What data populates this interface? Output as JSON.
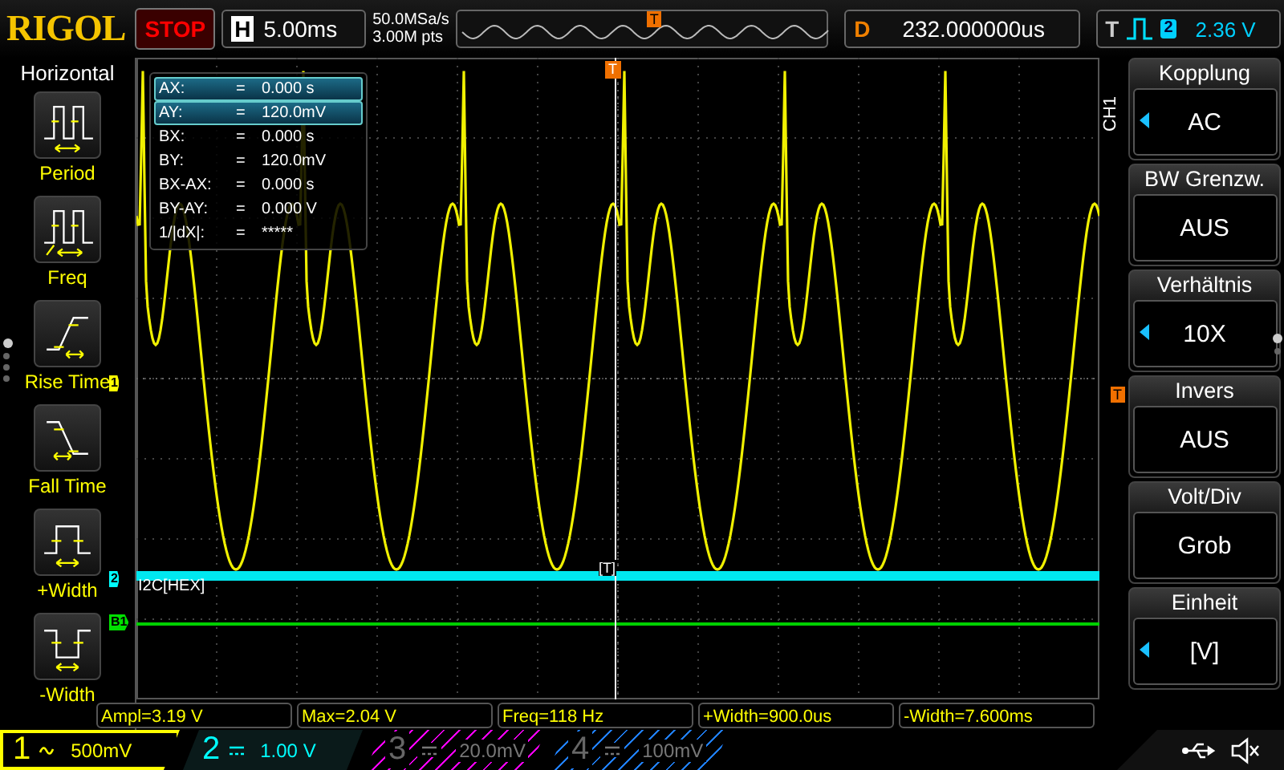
{
  "header": {
    "logo": "RIGOL",
    "run_state": "STOP",
    "timebase_label": "H",
    "timebase": "5.00ms",
    "sample_rate": "50.0MSa/s",
    "memory_depth": "3.00M pts",
    "trigger_marker": "T",
    "delay_label": "D",
    "delay": "232.000000us",
    "trigger_label": "T",
    "trigger_source": "2",
    "trigger_level": "2.36 V"
  },
  "sidebar": {
    "title": "Horizontal",
    "items": [
      {
        "label": "Period",
        "kind": "period"
      },
      {
        "label": "Freq",
        "kind": "freq"
      },
      {
        "label": "Rise Time",
        "kind": "rise"
      },
      {
        "label": "Fall Time",
        "kind": "fall"
      },
      {
        "label": "+Width",
        "kind": "pwidth"
      },
      {
        "label": "-Width",
        "kind": "nwidth"
      }
    ],
    "pages": [
      {
        "selected": true
      },
      {
        "selected": false
      },
      {
        "selected": false
      },
      {
        "selected": false
      }
    ]
  },
  "plot": {
    "top_marker": "T",
    "trigger_marker": "T",
    "decode_label": "I2C[HEX]",
    "cursor_marker": "[T]",
    "markers": [
      {
        "label": "1",
        "kind": "analog",
        "color": "#ffff00"
      },
      {
        "label": "2",
        "kind": "decode",
        "color": "#00ffff"
      },
      {
        "label": "B1",
        "kind": "bus",
        "color": "#00e000"
      }
    ],
    "cursor_readout": [
      {
        "label": "AX:",
        "eq": "=",
        "value": "0.000 s",
        "selected": true
      },
      {
        "label": "AY:",
        "eq": "=",
        "value": "120.0mV",
        "selected": true
      },
      {
        "label": "BX:",
        "eq": "=",
        "value": "0.000 s",
        "selected": false
      },
      {
        "label": "BY:",
        "eq": "=",
        "value": "120.0mV",
        "selected": false
      },
      {
        "label": "BX-AX:",
        "eq": "=",
        "value": "0.000 s",
        "selected": false
      },
      {
        "label": "BY-AY:",
        "eq": "=",
        "value": "0.000 V",
        "selected": false
      },
      {
        "label": "1/|dX|:",
        "eq": "=",
        "value": "*****",
        "selected": false
      }
    ]
  },
  "menu": {
    "channel": "CH1",
    "items": [
      {
        "title": "Kopplung",
        "value": "AC",
        "adjustable": true
      },
      {
        "title": "BW Grenzw.",
        "value": "AUS",
        "adjustable": false
      },
      {
        "title": "Verhältnis",
        "value": "10X",
        "adjustable": true
      },
      {
        "title": "Invers",
        "value": "AUS",
        "adjustable": false
      },
      {
        "title": "Volt/Div",
        "value": "Grob",
        "adjustable": false
      },
      {
        "title": "Einheit",
        "value": "[V]",
        "adjustable": true
      }
    ],
    "pages": [
      {
        "selected": true
      },
      {
        "selected": false
      }
    ]
  },
  "measurements": [
    "Ampl=3.19 V",
    "Max=2.04 V",
    "Freq=118 Hz",
    "+Width=900.0us",
    "-Width=7.600ms"
  ],
  "channels": [
    {
      "number": "1",
      "kind": "ac",
      "scale": "500mV",
      "enabled": true,
      "selected": true,
      "color": "#ffff00"
    },
    {
      "number": "2",
      "kind": "dc",
      "scale": "1.00 V",
      "enabled": true,
      "selected": false,
      "color": "#00ffff"
    },
    {
      "number": "3",
      "kind": "dc",
      "scale": "20.0mV",
      "enabled": false,
      "selected": false,
      "color": "#ff00ff"
    },
    {
      "number": "4",
      "kind": "dc",
      "scale": "100mV",
      "enabled": false,
      "selected": false,
      "color": "#2080ff"
    }
  ]
}
